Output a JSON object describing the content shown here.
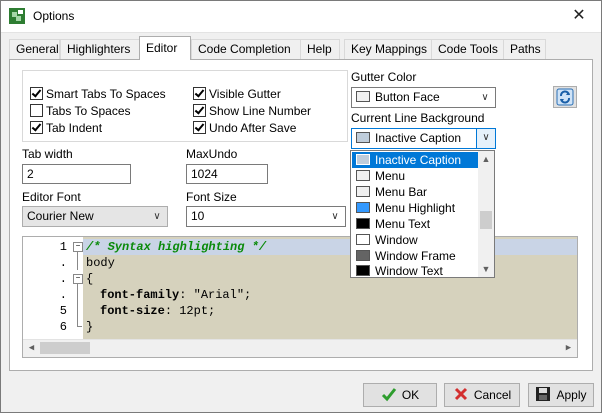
{
  "window": {
    "title": "Options",
    "close_glyph": "✕"
  },
  "tabs": [
    {
      "label": "General"
    },
    {
      "label": "Highlighters"
    },
    {
      "label": "Editor"
    },
    {
      "label": "Code Completion"
    },
    {
      "label": "Help"
    },
    {
      "label": "Key Mappings"
    },
    {
      "label": "Code Tools"
    },
    {
      "label": "Paths"
    }
  ],
  "active_tab": "Editor",
  "options": {
    "smart_tabs": {
      "label": "Smart Tabs To Spaces",
      "checked": true
    },
    "tabs_to_spaces": {
      "label": "Tabs To Spaces",
      "checked": false
    },
    "tab_indent": {
      "label": "Tab Indent",
      "checked": true
    },
    "visible_gutter": {
      "label": "Visible Gutter",
      "checked": true
    },
    "show_line_number": {
      "label": "Show Line Number",
      "checked": true
    },
    "undo_after_save": {
      "label": "Undo After Save",
      "checked": true
    }
  },
  "fields": {
    "tab_width": {
      "label": "Tab width",
      "value": "2"
    },
    "max_undo": {
      "label": "MaxUndo",
      "value": "1024"
    },
    "editor_font": {
      "label": "Editor Font",
      "value": "Courier New"
    },
    "font_size": {
      "label": "Font Size",
      "value": "10"
    },
    "gutter_color": {
      "label": "Gutter Color",
      "value": "Button Face"
    },
    "current_line_bg": {
      "label": "Current Line Background",
      "value": "Inactive Caption"
    }
  },
  "colors": {
    "gutter_swatch": "#f0f0f0",
    "inactive_caption": "#bfcddb",
    "accent": "#0078d7",
    "code_bg": "#d6d2bd"
  },
  "dropdown_items": [
    {
      "label": "Inactive Caption",
      "color": "#bfcddb",
      "selected": true
    },
    {
      "label": "Menu",
      "color": "#f0f0f0"
    },
    {
      "label": "Menu Bar",
      "color": "#f0f0f0"
    },
    {
      "label": "Menu Highlight",
      "color": "#3399ff"
    },
    {
      "label": "Menu Text",
      "color": "#000000"
    },
    {
      "label": "Window",
      "color": "#ffffff"
    },
    {
      "label": "Window Frame",
      "color": "#646464"
    },
    {
      "label": "Window Text",
      "color": "#000000"
    }
  ],
  "code": {
    "line_numbers": [
      "1",
      ".",
      ".",
      ".",
      "5",
      "6"
    ],
    "line1": "/* Syntax highlighting */",
    "line2": "body",
    "line3": "{",
    "line4_prop": "font-family",
    "line4_rest": ": \"Arial\";",
    "line5_prop": "font-size",
    "line5_rest": ": 12pt;",
    "line6": "}"
  },
  "buttons": {
    "ok": "OK",
    "cancel": "Cancel",
    "apply": "Apply"
  },
  "icons": {
    "app": "app-icon",
    "refresh": "refresh-icon",
    "ok": "checkmark-icon",
    "cancel": "x-icon",
    "apply": "save-disk-icon"
  }
}
